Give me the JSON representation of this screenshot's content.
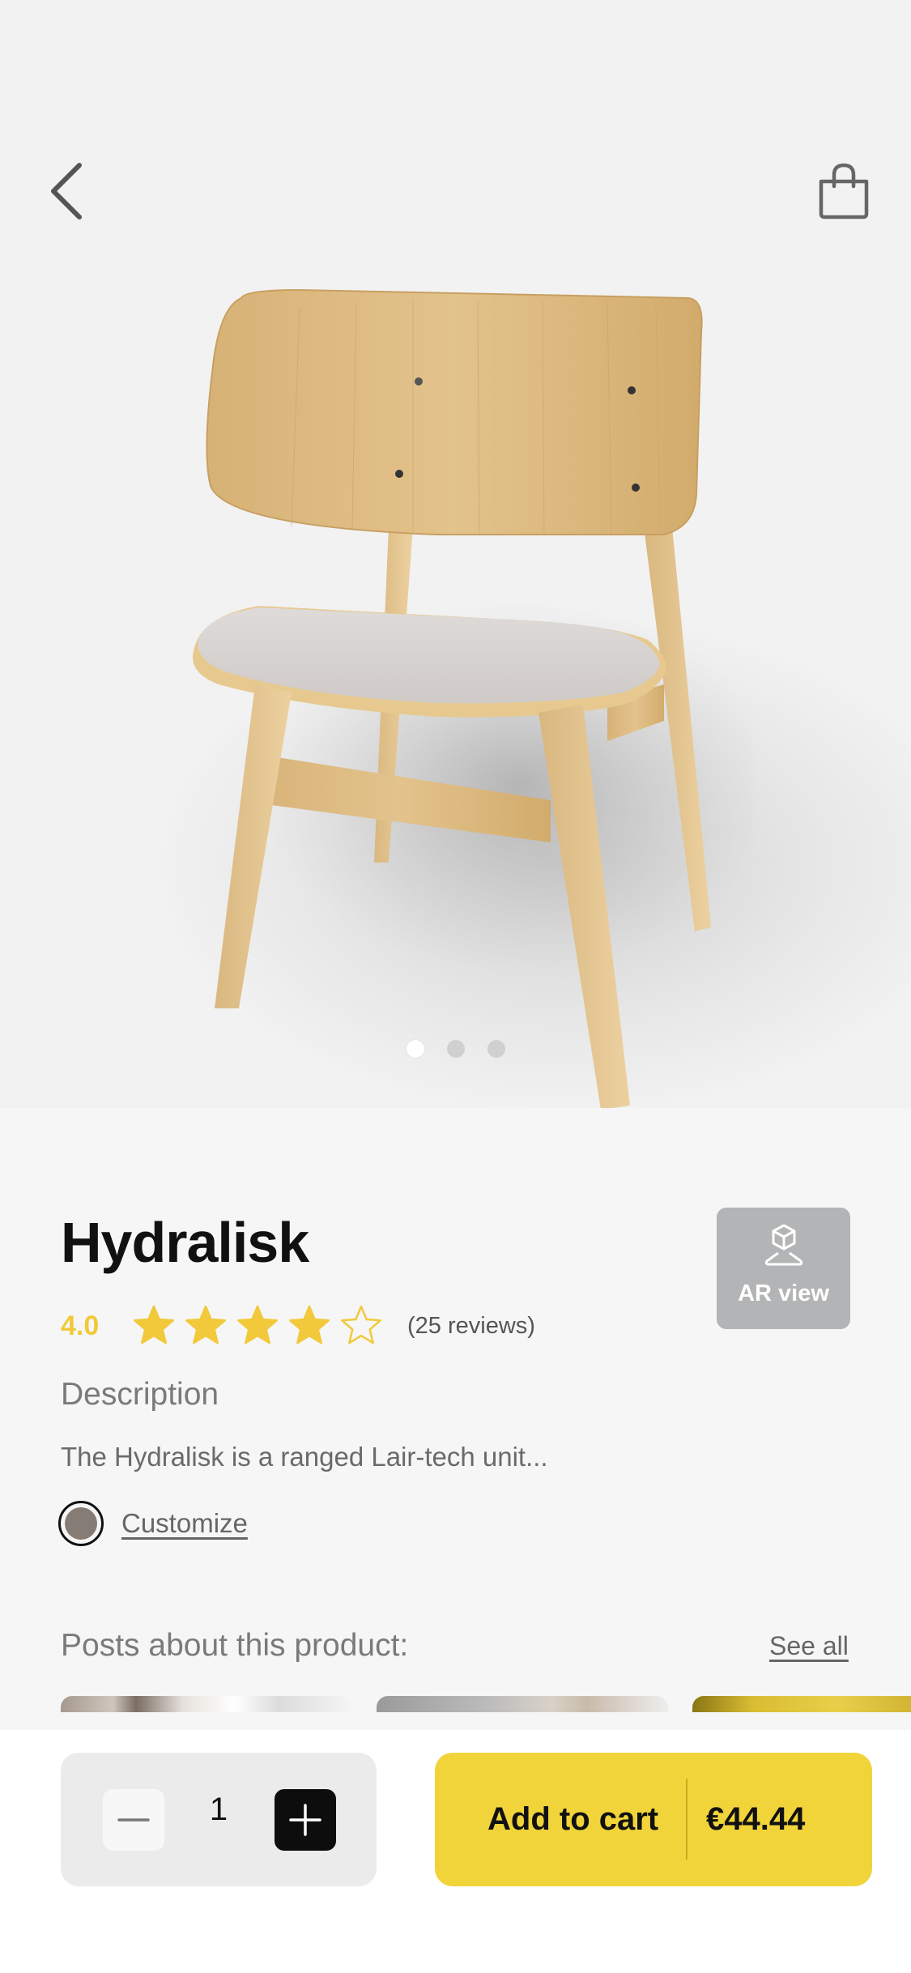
{
  "product": {
    "name": "Hydralisk",
    "rating_value": "4.0",
    "rating": 4,
    "rating_max": 5,
    "reviews_label": "(25 reviews)",
    "description_heading": "Description",
    "description_text": "The Hydralisk is a ranged Lair-tech unit...",
    "customize_label": "Customize",
    "selected_color": "#857c75"
  },
  "header": {
    "back_icon": "chevron-left-icon",
    "bag_icon": "shopping-bag-icon"
  },
  "gallery": {
    "image_count": 3,
    "active_index": 0
  },
  "ar_button": {
    "label": "AR view",
    "icon": "ar-cube-icon"
  },
  "posts": {
    "heading": "Posts about this product:",
    "see_all_label": "See all"
  },
  "cart": {
    "quantity": "1",
    "add_label": "Add to cart",
    "price": "€44.44"
  },
  "colors": {
    "accent": "#f0d43a",
    "star": "#f1c93a",
    "ar_button_bg": "#b3b4b5"
  }
}
